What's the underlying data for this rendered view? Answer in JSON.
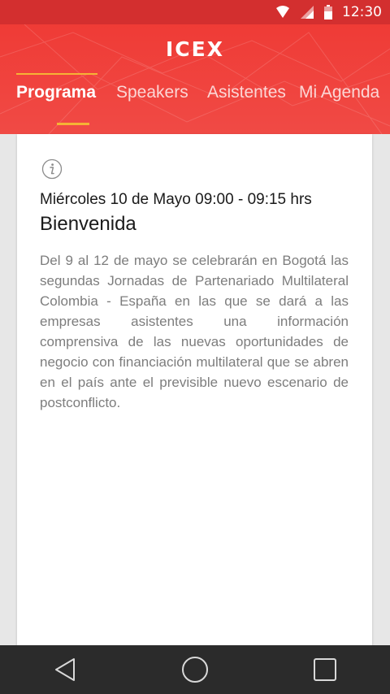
{
  "status_bar": {
    "time": "12:30",
    "icons": [
      "wifi-icon",
      "signal-icon",
      "battery-icon"
    ]
  },
  "header": {
    "logo_text": "ICEX",
    "colors": {
      "background": "#ef3b36",
      "accent": "#f5b335"
    }
  },
  "tabs": [
    {
      "label": "Programa",
      "active": true
    },
    {
      "label": "Speakers",
      "active": false
    },
    {
      "label": "Asistentes",
      "active": false
    },
    {
      "label": "Mi Agenda",
      "active": false
    }
  ],
  "event": {
    "info_icon": "info-icon",
    "datetime": "Miércoles 10 de Mayo 09:00 - 09:15 hrs",
    "title": "Bienvenida",
    "description": "Del 9 al 12 de mayo se celebrarán en Bogotá las segundas Jornadas de Partenariado Multilateral Colombia - España en las que se dará a las empresas asistentes una información comprensiva de las nuevas oportunidades de negocio con financiación multilateral que se abren en el país ante el previsible nuevo escenario de postconflicto."
  },
  "nav_bar": {
    "buttons": [
      "back-icon",
      "home-icon",
      "recents-icon"
    ]
  }
}
